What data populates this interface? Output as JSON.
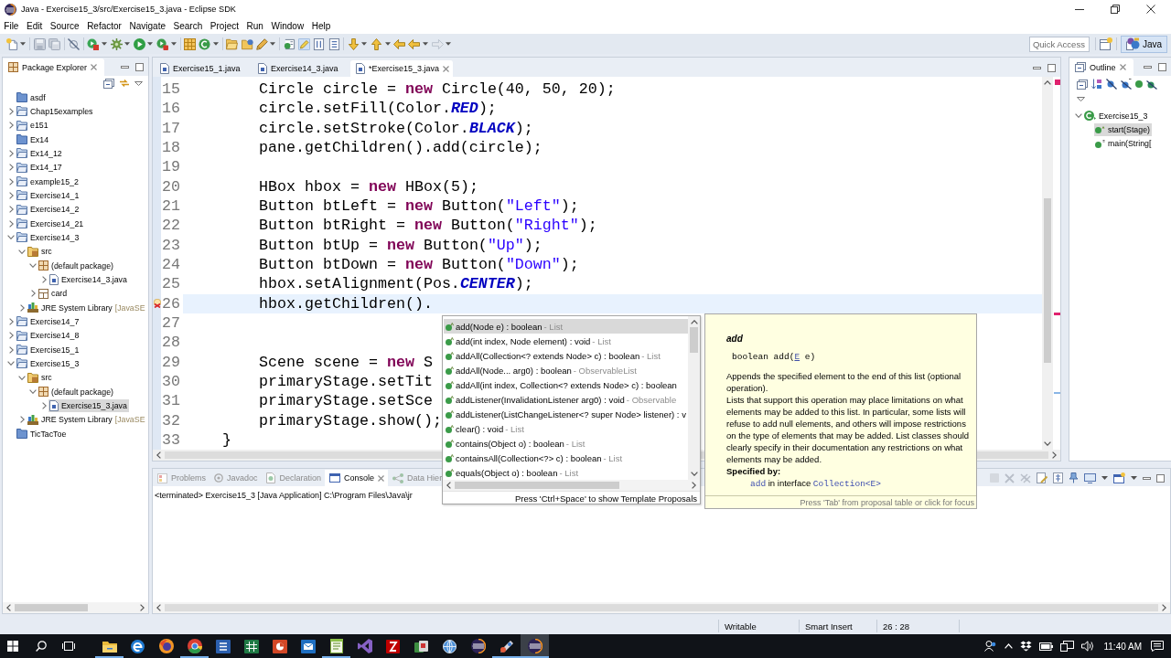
{
  "window": {
    "title": "Java - Exercise15_3/src/Exercise15_3.java - Eclipse SDK"
  },
  "menu": [
    "File",
    "Edit",
    "Source",
    "Refactor",
    "Navigate",
    "Search",
    "Project",
    "Run",
    "Window",
    "Help"
  ],
  "toolbar": {
    "highlight_toggle": {
      "on": true
    },
    "quick_access": {
      "placeholder": "Quick Access"
    },
    "perspectives": [
      {
        "label": "Java",
        "selected": true
      }
    ]
  },
  "package_explorer": {
    "title": "Package Explorer",
    "tree": [
      {
        "kind": "closed_project",
        "label": "asdf",
        "selected": false
      },
      {
        "kind": "project",
        "label": "Chap15examples",
        "expanded": false,
        "selected": false
      },
      {
        "kind": "project",
        "label": "e151",
        "expanded": false,
        "selected": false
      },
      {
        "kind": "closed_project",
        "label": "Ex14",
        "selected": false
      },
      {
        "kind": "project",
        "label": "Ex14_12",
        "expanded": false,
        "selected": false
      },
      {
        "kind": "project",
        "label": "Ex14_17",
        "expanded": false,
        "selected": false
      },
      {
        "kind": "project",
        "label": "example15_2",
        "expanded": false,
        "selected": false
      },
      {
        "kind": "project",
        "label": "Exercise14_1",
        "expanded": false,
        "selected": false
      },
      {
        "kind": "project",
        "label": "Exercise14_2",
        "expanded": false,
        "selected": false
      },
      {
        "kind": "project",
        "label": "Exercise14_21",
        "expanded": false,
        "selected": false
      },
      {
        "kind": "project",
        "label": "Exercise14_3",
        "expanded": true,
        "selected": false,
        "children": [
          {
            "kind": "source_folder",
            "label": "src",
            "expanded": true,
            "selected": false,
            "children": [
              {
                "kind": "package",
                "label": "(default package)",
                "expanded": true,
                "selected": false,
                "children": [
                  {
                    "kind": "java_file",
                    "label": "Exercise14_3.java",
                    "expanded": false,
                    "selected": false
                  }
                ]
              },
              {
                "kind": "folder",
                "label": "card",
                "expanded": false,
                "selected": false
              }
            ]
          },
          {
            "kind": "library",
            "label": "JRE System Library",
            "qualifier": "[JavaSE",
            "expanded": false,
            "selected": false
          }
        ]
      },
      {
        "kind": "project",
        "label": "Exercise14_7",
        "expanded": false,
        "selected": false
      },
      {
        "kind": "project",
        "label": "Exercise14_8",
        "expanded": false,
        "selected": false
      },
      {
        "kind": "project",
        "label": "Exercise15_1",
        "expanded": false,
        "selected": false
      },
      {
        "kind": "project",
        "label": "Exercise15_3",
        "expanded": true,
        "selected": false,
        "children": [
          {
            "kind": "source_folder",
            "label": "src",
            "expanded": true,
            "selected": false,
            "children": [
              {
                "kind": "package",
                "label": "(default package)",
                "expanded": true,
                "selected": false,
                "children": [
                  {
                    "kind": "java_file",
                    "label": "Exercise15_3.java",
                    "expanded": false,
                    "selected": true
                  }
                ]
              }
            ]
          },
          {
            "kind": "library",
            "label": "JRE System Library",
            "qualifier": "[JavaSE",
            "expanded": false,
            "selected": false
          }
        ]
      },
      {
        "kind": "closed_project",
        "label": "TicTacToe",
        "selected": false
      }
    ]
  },
  "editor": {
    "tabs": [
      {
        "label": "Exercise15_1.java",
        "selected": false
      },
      {
        "label": "Exercise14_3.java",
        "selected": false
      },
      {
        "label": "*Exercise15_3.java",
        "selected": true
      }
    ],
    "lines": [
      {
        "number": "15",
        "current": false,
        "error": false,
        "code": [
          {
            "kind": "plain",
            "text": "        Circle circle = "
          },
          {
            "kind": "keyword",
            "text": "new"
          },
          {
            "kind": "plain",
            "text": " Circle(40, 50, 20);"
          }
        ]
      },
      {
        "number": "16",
        "current": false,
        "error": false,
        "code": [
          {
            "kind": "plain",
            "text": "        circle.setFill(Color."
          },
          {
            "kind": "constant",
            "text": "RED"
          },
          {
            "kind": "plain",
            "text": ");"
          }
        ]
      },
      {
        "number": "17",
        "current": false,
        "error": false,
        "code": [
          {
            "kind": "plain",
            "text": "        circle.setStroke(Color."
          },
          {
            "kind": "constant",
            "text": "BLACK"
          },
          {
            "kind": "plain",
            "text": ");"
          }
        ]
      },
      {
        "number": "18",
        "current": false,
        "error": false,
        "code": [
          {
            "kind": "plain",
            "text": "        pane.getChildren().add(circle);"
          }
        ]
      },
      {
        "number": "19",
        "current": false,
        "error": false
      },
      {
        "number": "20",
        "current": false,
        "error": false,
        "code": [
          {
            "kind": "plain",
            "text": "        HBox hbox = "
          },
          {
            "kind": "keyword",
            "text": "new"
          },
          {
            "kind": "plain",
            "text": " HBox(5);"
          }
        ]
      },
      {
        "number": "21",
        "current": false,
        "error": false,
        "code": [
          {
            "kind": "plain",
            "text": "        Button btLeft = "
          },
          {
            "kind": "keyword",
            "text": "new"
          },
          {
            "kind": "plain",
            "text": " Button("
          },
          {
            "kind": "string",
            "text": "\"Left\""
          },
          {
            "kind": "plain",
            "text": ");"
          }
        ]
      },
      {
        "number": "22",
        "current": false,
        "error": false,
        "code": [
          {
            "kind": "plain",
            "text": "        Button btRight = "
          },
          {
            "kind": "keyword",
            "text": "new"
          },
          {
            "kind": "plain",
            "text": " Button("
          },
          {
            "kind": "string",
            "text": "\"Right\""
          },
          {
            "kind": "plain",
            "text": ");"
          }
        ]
      },
      {
        "number": "23",
        "current": false,
        "error": false,
        "code": [
          {
            "kind": "plain",
            "text": "        Button btUp = "
          },
          {
            "kind": "keyword",
            "text": "new"
          },
          {
            "kind": "plain",
            "text": " Button("
          },
          {
            "kind": "string",
            "text": "\"Up\""
          },
          {
            "kind": "plain",
            "text": ");"
          }
        ]
      },
      {
        "number": "24",
        "current": false,
        "error": false,
        "code": [
          {
            "kind": "plain",
            "text": "        Button btDown = "
          },
          {
            "kind": "keyword",
            "text": "new"
          },
          {
            "kind": "plain",
            "text": " Button("
          },
          {
            "kind": "string",
            "text": "\"Down\""
          },
          {
            "kind": "plain",
            "text": ");"
          }
        ]
      },
      {
        "number": "25",
        "current": false,
        "error": false,
        "code": [
          {
            "kind": "plain",
            "text": "        hbox.setAlignment(Pos."
          },
          {
            "kind": "constant",
            "text": "CENTER"
          },
          {
            "kind": "plain",
            "text": ");"
          }
        ]
      },
      {
        "number": "26",
        "current": true,
        "error": true,
        "code": [
          {
            "kind": "plain",
            "text": "        hbox.getChildren()."
          }
        ]
      },
      {
        "number": "27",
        "current": false,
        "error": false
      },
      {
        "number": "28",
        "current": false,
        "error": false
      },
      {
        "number": "29",
        "current": false,
        "error": false,
        "code": [
          {
            "kind": "plain",
            "text": "        Scene scene = "
          },
          {
            "kind": "keyword",
            "text": "new"
          },
          {
            "kind": "plain",
            "text": " S"
          }
        ]
      },
      {
        "number": "30",
        "current": false,
        "error": false,
        "code": [
          {
            "kind": "plain",
            "text": "        primaryStage.setTit"
          }
        ]
      },
      {
        "number": "31",
        "current": false,
        "error": false,
        "code": [
          {
            "kind": "plain",
            "text": "        primaryStage.setSce"
          }
        ]
      },
      {
        "number": "32",
        "current": false,
        "error": false,
        "code": [
          {
            "kind": "plain",
            "text": "        primaryStage.show();"
          }
        ]
      },
      {
        "number": "33",
        "current": false,
        "error": false,
        "code": [
          {
            "kind": "plain",
            "text": "    }"
          }
        ]
      }
    ]
  },
  "outline": {
    "title": "Outline",
    "tree": [
      {
        "kind": "class",
        "label": "Exercise15_3",
        "expanded": true,
        "selected": false,
        "children": [
          {
            "kind": "method",
            "label": "start(Stage)",
            "selected": true
          },
          {
            "kind": "static_method",
            "label": "main(String[",
            "selected": false
          }
        ]
      }
    ]
  },
  "bottom_panel": {
    "tabs": [
      {
        "kind": "problems",
        "label": "Problems",
        "selected": false
      },
      {
        "kind": "javadoc",
        "label": "Javadoc",
        "selected": false
      },
      {
        "kind": "declaration",
        "label": "Declaration",
        "selected": false
      },
      {
        "kind": "console",
        "label": "Console",
        "selected": true
      },
      {
        "kind": "hierarchy",
        "label": "Data Hier",
        "selected": false
      }
    ],
    "console": "<terminated> Exercise15_3 [Java Application] C:\\Program Files\\Java\\jr"
  },
  "completion": {
    "items": [
      {
        "kind": "method",
        "label": "add(Node e) : boolean",
        "qualifier": "- List",
        "selected": true
      },
      {
        "kind": "method",
        "label": "add(int index, Node element) : void",
        "qualifier": "- List",
        "selected": false
      },
      {
        "kind": "method",
        "label": "addAll(Collection<? extends Node> c) : boolean",
        "qualifier": "- List",
        "selected": false
      },
      {
        "kind": "method",
        "label": "addAll(Node... arg0) : boolean",
        "qualifier": "- ObservableList",
        "selected": false
      },
      {
        "kind": "method",
        "label": "addAll(int index, Collection<? extends Node> c) : boolean",
        "selected": false
      },
      {
        "kind": "method",
        "label": "addListener(InvalidationListener arg0) : void",
        "qualifier": "- Observable",
        "selected": false
      },
      {
        "kind": "method",
        "label": "addListener(ListChangeListener<? super Node> listener) : v",
        "selected": false
      },
      {
        "kind": "method",
        "label": "clear() : void",
        "qualifier": "- List",
        "selected": false
      },
      {
        "kind": "method",
        "label": "contains(Object o) : boolean",
        "qualifier": "- List",
        "selected": false
      },
      {
        "kind": "method",
        "label": "containsAll(Collection<?> c) : boolean",
        "qualifier": "- List",
        "selected": false
      },
      {
        "kind": "method",
        "label": "equals(Object o) : boolean",
        "qualifier": "- List",
        "selected": false
      }
    ],
    "hint": "Press 'Ctrl+Space' to show Template Proposals"
  },
  "javadoc": {
    "title": "add",
    "signature": {
      "before": "boolean add(",
      "link": "E",
      "after": " e)"
    },
    "paragraphs": [
      "Appends the specified element to the end of this list (optional operation).",
      "Lists that support this operation may place limitations on what elements may be added to this list. In particular, some lists will refuse to add null elements, and others will impose restrictions on the type of elements that may be added. List classes should clearly specify in their documentation any restrictions on what elements may be added."
    ],
    "specified_by": {
      "label": "Specified by:",
      "link": "add",
      "text": " in interface ",
      "type_link": "Collection<E>"
    },
    "hint": "Press 'Tab' from proposal table or click for focus"
  },
  "status_bar": [
    "Writable",
    "Smart Insert",
    "26 : 28"
  ],
  "taskbar": {
    "apps": [
      {
        "kind": "folder",
        "running": true,
        "active": false
      },
      {
        "kind": "swirl",
        "running": false,
        "active": false
      },
      {
        "kind": "flame",
        "running": false,
        "active": false
      },
      {
        "kind": "wheel",
        "running": true,
        "active": false
      },
      {
        "kind": "document",
        "running": false,
        "active": false
      },
      {
        "kind": "spreadsheet",
        "running": false,
        "active": false
      },
      {
        "kind": "slides",
        "running": false,
        "active": false
      },
      {
        "kind": "mail",
        "running": false,
        "active": false
      },
      {
        "kind": "notepad",
        "running": true,
        "active": false
      },
      {
        "kind": "ribbon",
        "running": false,
        "active": false
      },
      {
        "kind": "bolt",
        "running": false,
        "active": false
      },
      {
        "kind": "cards",
        "running": false,
        "active": false
      },
      {
        "kind": "globe",
        "running": false,
        "active": false
      },
      {
        "kind": "orb",
        "running": false,
        "active": false
      },
      {
        "kind": "brush",
        "running": true,
        "active": false
      },
      {
        "kind": "orb",
        "running": true,
        "active": true
      }
    ],
    "time": "11:40 AM"
  }
}
